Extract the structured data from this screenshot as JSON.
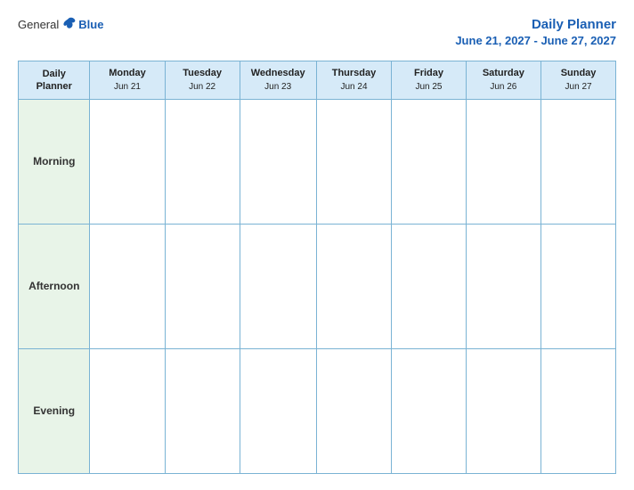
{
  "header": {
    "logo": {
      "general": "General",
      "blue": "Blue"
    },
    "title": "Daily Planner",
    "subtitle": "June 21, 2027 - June 27, 2027"
  },
  "columns": [
    {
      "name": "Daily\nPlanner",
      "date": ""
    },
    {
      "name": "Monday",
      "date": "Jun 21"
    },
    {
      "name": "Tuesday",
      "date": "Jun 22"
    },
    {
      "name": "Wednesday",
      "date": "Jun 23"
    },
    {
      "name": "Thursday",
      "date": "Jun 24"
    },
    {
      "name": "Friday",
      "date": "Jun 25"
    },
    {
      "name": "Saturday",
      "date": "Jun 26"
    },
    {
      "name": "Sunday",
      "date": "Jun 27"
    }
  ],
  "rows": [
    {
      "label": "Morning"
    },
    {
      "label": "Afternoon"
    },
    {
      "label": "Evening"
    }
  ]
}
